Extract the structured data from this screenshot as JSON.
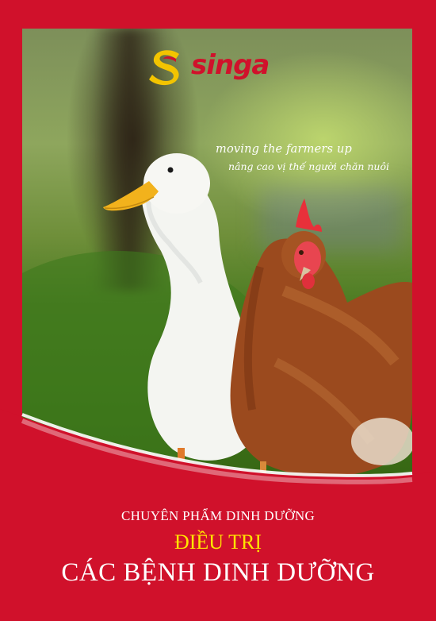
{
  "brand": {
    "name": "singa",
    "colors": {
      "background": "#d0112b",
      "accent_yellow": "#ffe400",
      "logo_yellow": "#f3c400",
      "logo_red": "#d0112b"
    }
  },
  "photo": {
    "subject": "duck-and-hen-photo"
  },
  "tagline": {
    "english": "moving the farmers up",
    "vietnamese": "nâng cao vị thế người chăn nuôi"
  },
  "titles": {
    "line1": "CHUYÊN PHẨM DINH DƯỠNG",
    "line2": "ĐIỀU TRỊ",
    "line3": "CÁC BỆNH DINH DƯỠNG"
  }
}
